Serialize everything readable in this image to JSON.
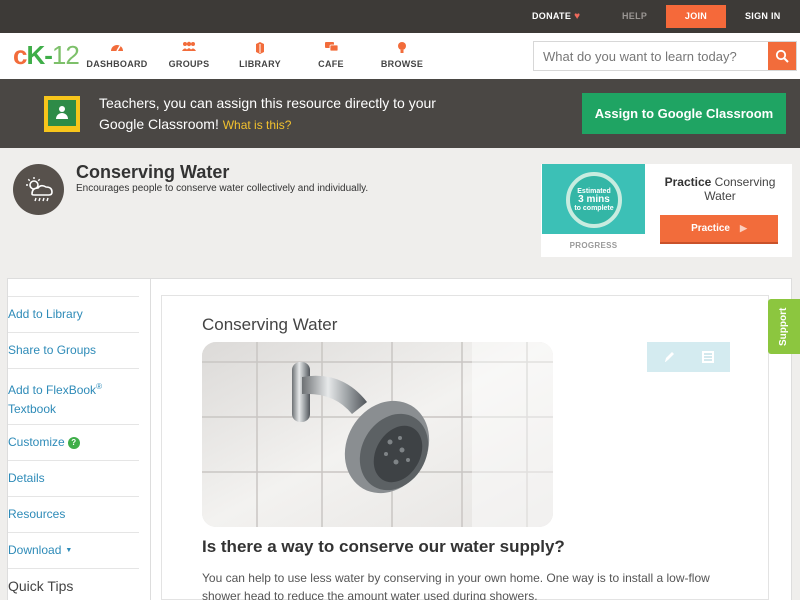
{
  "topbar": {
    "donate": "DONATE",
    "help": "HELP",
    "join": "JOIN",
    "sign_in": "SIGN IN"
  },
  "logo": {
    "c": "c",
    "k": "K",
    "dash": "-",
    "num": "12"
  },
  "nav": [
    {
      "label": "DASHBOARD",
      "icon": "dashboard-icon"
    },
    {
      "label": "GROUPS",
      "icon": "groups-icon"
    },
    {
      "label": "LIBRARY",
      "icon": "library-icon"
    },
    {
      "label": "CAFE",
      "icon": "cafe-icon"
    },
    {
      "label": "BROWSE",
      "icon": "browse-icon"
    }
  ],
  "search": {
    "placeholder": "What do you want to learn today?"
  },
  "banner": {
    "text": "Teachers, you can assign this resource directly to your Google Classroom!",
    "what_link": "What is this?",
    "assign_button": "Assign to Google Classroom"
  },
  "topic": {
    "title": "Conserving Water",
    "description": "Encourages people to conserve water collectively and individually."
  },
  "practice_card": {
    "estimated": "Estimated",
    "minutes": "3 mins",
    "to_complete": "to complete",
    "progress_label": "PROGRESS",
    "practice_word": "Practice",
    "practice_topic": "Conserving Water",
    "button": "Practice"
  },
  "sidebar": {
    "add_library": "Add to Library",
    "share_groups": "Share to Groups",
    "add_flexbook": "Add to FlexBook",
    "flexbook_reg": "®",
    "textbook": "Textbook",
    "customize": "Customize",
    "details": "Details",
    "resources": "Resources",
    "download": "Download",
    "quick_tips": "Quick Tips"
  },
  "main": {
    "title": "Conserving Water",
    "heading": "Is there a way to conserve our water supply?",
    "paragraph": "You can help to use less water by conserving in your own home. One way is to install a low-flow shower head to reduce the amount water used during showers."
  },
  "support": {
    "label": "Support"
  },
  "colors": {
    "brand_orange": "#f26c3b",
    "brand_green": "#3fae49",
    "google_green": "#1fa463",
    "link_blue": "#2e8bb8",
    "support_green": "#8cc63f"
  }
}
